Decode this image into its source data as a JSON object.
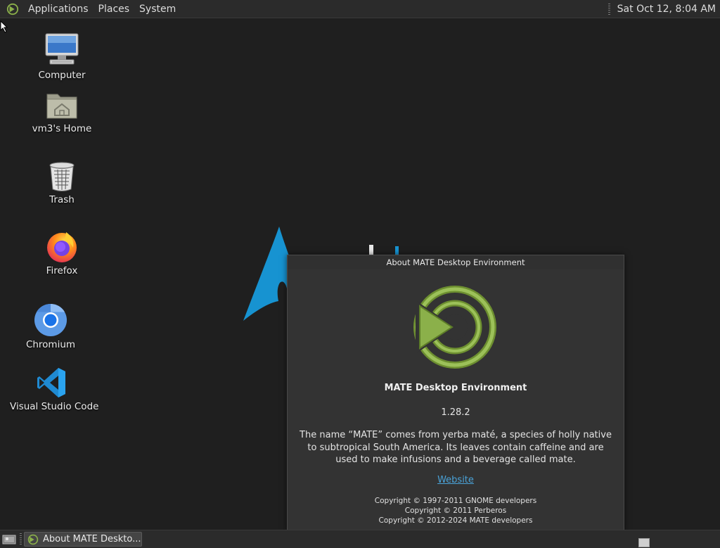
{
  "top_panel": {
    "menus": [
      "Applications",
      "Places",
      "System"
    ],
    "clock": "Sat Oct 12,  8:04 AM"
  },
  "desktop": {
    "icons": [
      {
        "label": "Computer",
        "icon": "computer-icon"
      },
      {
        "label": "vm3's Home",
        "icon": "home-folder-icon"
      },
      {
        "label": "Trash",
        "icon": "trash-icon"
      },
      {
        "label": "Firefox",
        "icon": "firefox-icon"
      },
      {
        "label": "Chromium",
        "icon": "chromium-icon"
      },
      {
        "label": "Visual Studio Code",
        "icon": "vscode-icon"
      }
    ]
  },
  "about_dialog": {
    "title": "About MATE Desktop Environment",
    "name": "MATE Desktop Environment",
    "version": "1.28.2",
    "description": "The name “MATE” comes from yerba maté, a species of holly native to subtropical South America. Its leaves contain caffeine and are used to make infusions and a beverage called mate.",
    "website_label": "Website",
    "copyright": [
      "Copyright © 1997-2011 GNOME developers",
      "Copyright © 2011 Perberos",
      "Copyright © 2012-2024 MATE developers"
    ]
  },
  "bottom_panel": {
    "tasks": [
      {
        "label": "About MATE Deskto..."
      }
    ]
  },
  "colors": {
    "desktop_bg": "#1f1f1f",
    "panel_bg": "#2b2b2b",
    "mate_green": "#8bb04a",
    "link": "#4aa3d9",
    "arch_blue": "#1793d1"
  }
}
